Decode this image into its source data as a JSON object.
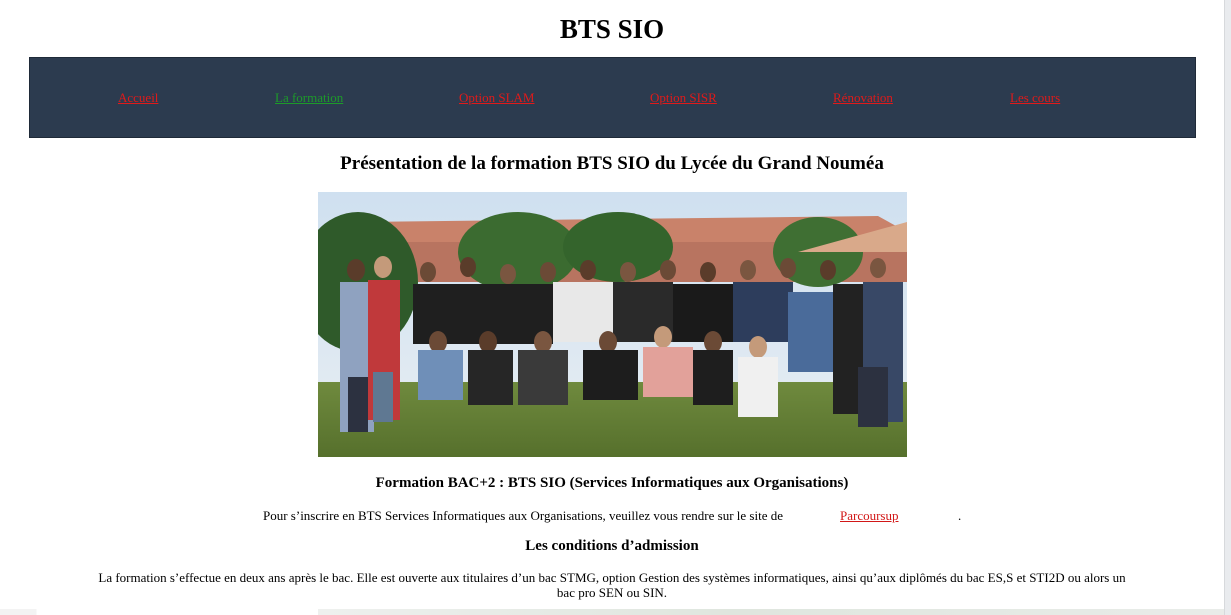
{
  "header": {
    "title": "BTS SIO"
  },
  "nav": {
    "items": [
      {
        "label": "Accueil",
        "active": false
      },
      {
        "label": "La formation",
        "active": true
      },
      {
        "label": "Option SLAM",
        "active": false
      },
      {
        "label": "Option SISR",
        "active": false
      },
      {
        "label": "Rénovation",
        "active": false
      },
      {
        "label": "Les cours",
        "active": false
      }
    ]
  },
  "main": {
    "section_title": "Présentation de la formation BTS SIO du Lycée du Grand Nouméa",
    "subtitle": "Formation BAC+2 : BTS SIO (Services Informatiques aux Organisations)",
    "inscription": {
      "text": "Pour s’inscrire en BTS Services Informatiques aux Organisations, veuillez vous rendre sur le site de",
      "link_label": "Parcoursup",
      "end": "."
    },
    "conditions_title": "Les conditions d’admission",
    "conditions_text": "La formation s’effectue en deux ans après le bac. Elle est ouverte aux titulaires d’un bac STMG, option Gestion des systèmes informatiques, ainsi qu’aux diplômés du bac ES,S et STI2D ou alors un bac pro SEN ou SIN."
  },
  "colors": {
    "nav_background": "#2c3b4f",
    "nav_link": "#e01a1a",
    "nav_link_active": "#1d9a2a",
    "link": "#d21717"
  }
}
